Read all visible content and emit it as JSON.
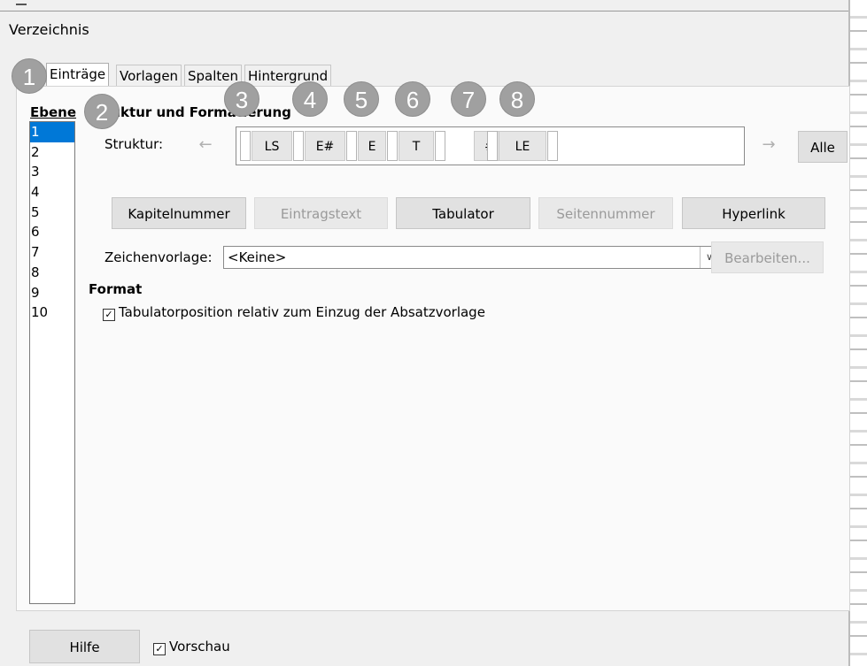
{
  "window": {
    "title": "Verzeichnis"
  },
  "tabs": [
    "Einträge",
    "Vorlagen",
    "Spalten",
    "Hintergrund"
  ],
  "levels": {
    "label": "Ebene",
    "items": [
      "1",
      "2",
      "3",
      "4",
      "5",
      "6",
      "7",
      "8",
      "9",
      "10"
    ],
    "selected": "1"
  },
  "structure": {
    "heading": "Struktur und Formatierung",
    "label": "Struktur:",
    "tokens": [
      "LS",
      "E#",
      "E",
      "T",
      "#",
      "LE"
    ],
    "prev_icon": "left-arrow-icon",
    "next_icon": "right-arrow-icon",
    "all_button": "Alle"
  },
  "insert_buttons": [
    {
      "label": "Kapitelnummer",
      "enabled": true
    },
    {
      "label": "Eintragstext",
      "enabled": false
    },
    {
      "label": "Tabulator",
      "enabled": true
    },
    {
      "label": "Seitennummer",
      "enabled": false
    },
    {
      "label": "Hyperlink",
      "enabled": true
    }
  ],
  "char_style": {
    "label": "Zeichenvorlage:",
    "value": "<Keine>",
    "edit_button": "Bearbeiten..."
  },
  "format": {
    "heading": "Format",
    "checkbox_label": "Tabulatorposition relativ zum Einzug der Absatzvorlage",
    "checked": true
  },
  "footer": {
    "help_button": "Hilfe",
    "preview_label": "Vorschau",
    "preview_checked": true
  },
  "badges": [
    "1",
    "2",
    "3",
    "4",
    "5",
    "6",
    "7",
    "8"
  ]
}
